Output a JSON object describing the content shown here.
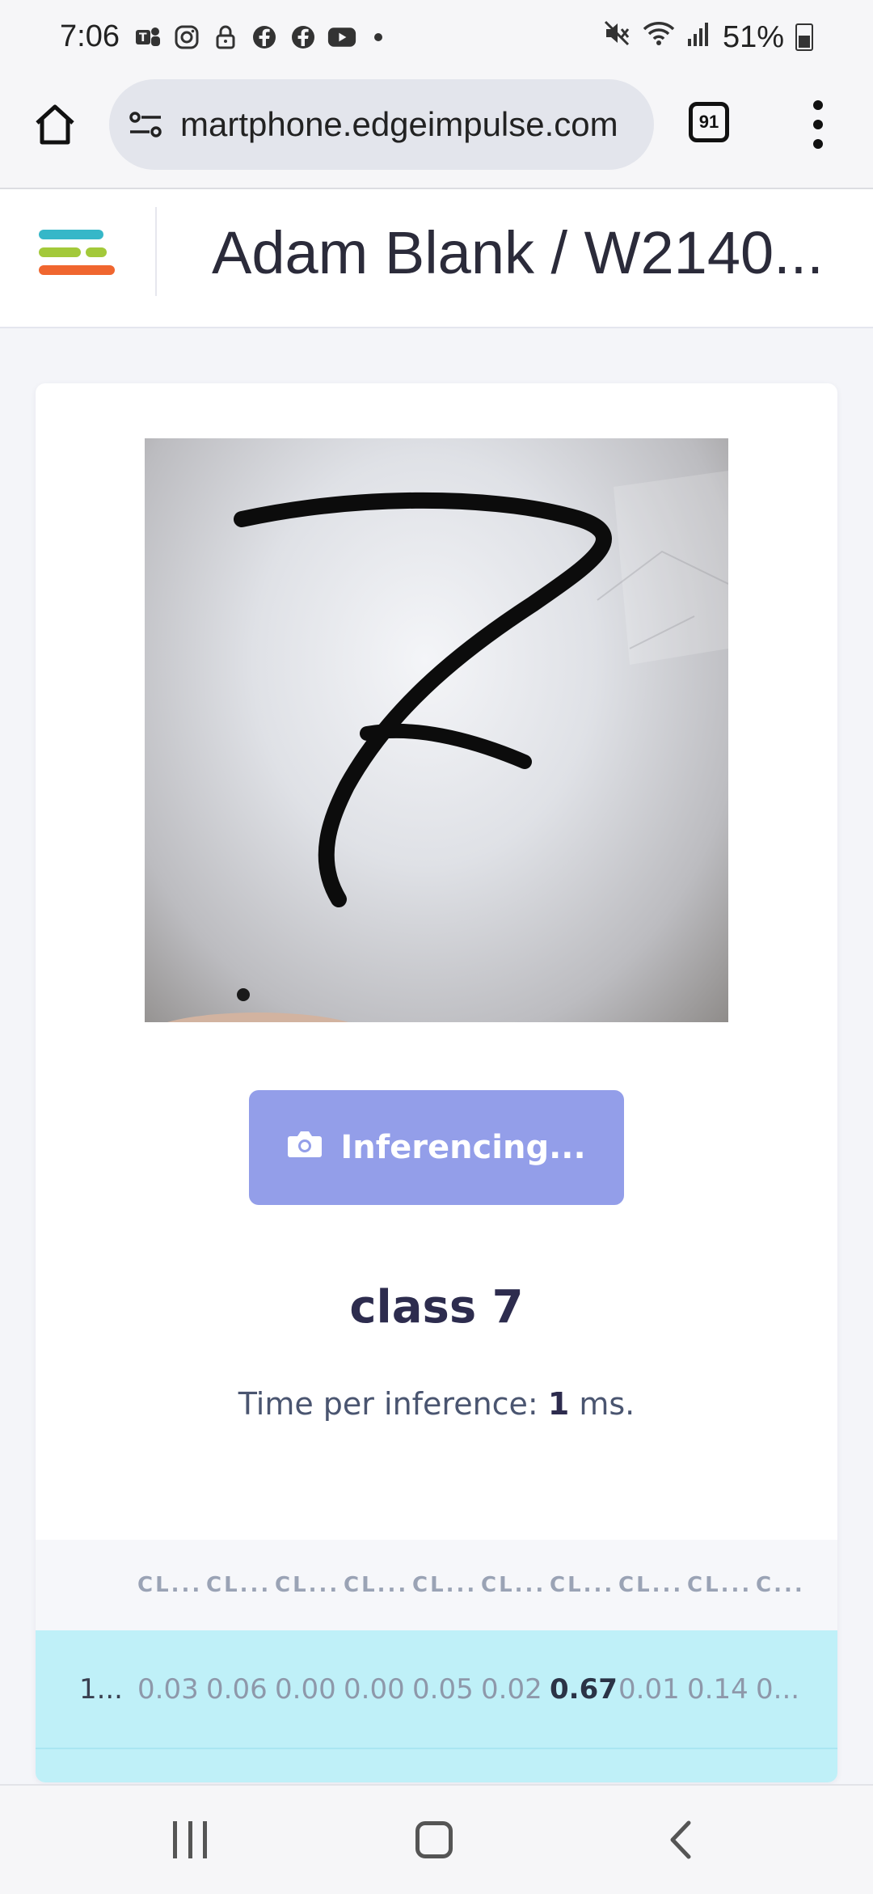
{
  "status_bar": {
    "time": "7:06",
    "battery": "51%",
    "left_icons": [
      "teams-icon",
      "instagram-icon",
      "lock-icon",
      "facebook-icon",
      "facebook-icon",
      "youtube-icon"
    ],
    "right_icons": [
      "mute-icon",
      "wifi-icon",
      "signal-icon",
      "battery-icon"
    ]
  },
  "browser": {
    "url": "martphone.edgeimpulse.com",
    "tab_count": "91"
  },
  "header": {
    "title": "Adam Blank / W2140..."
  },
  "capture": {
    "button_label": "Inferencing...",
    "button_icon": "camera-icon",
    "button_color": "#939ee9"
  },
  "result": {
    "class_label": "class 7",
    "timing_prefix": "Time per inference: ",
    "timing_value": "1",
    "timing_suffix": " ms."
  },
  "table": {
    "headers": [
      "",
      "CL...",
      "CL...",
      "CL...",
      "CL...",
      "CL...",
      "CL...",
      "CL...",
      "CL...",
      "CL...",
      "C..."
    ],
    "row": {
      "label": "1...",
      "values": [
        "0.03",
        "0.06",
        "0.00",
        "0.00",
        "0.05",
        "0.02",
        "0.67",
        "0.01",
        "0.14",
        "0..."
      ],
      "highlight_index": 6
    },
    "row_color": "#bff0f8"
  },
  "colors": {
    "logo_teal": "#36b7c8",
    "logo_lime": "#a3c93a",
    "logo_orange": "#f0662f",
    "title_text": "#2d2c4e"
  }
}
